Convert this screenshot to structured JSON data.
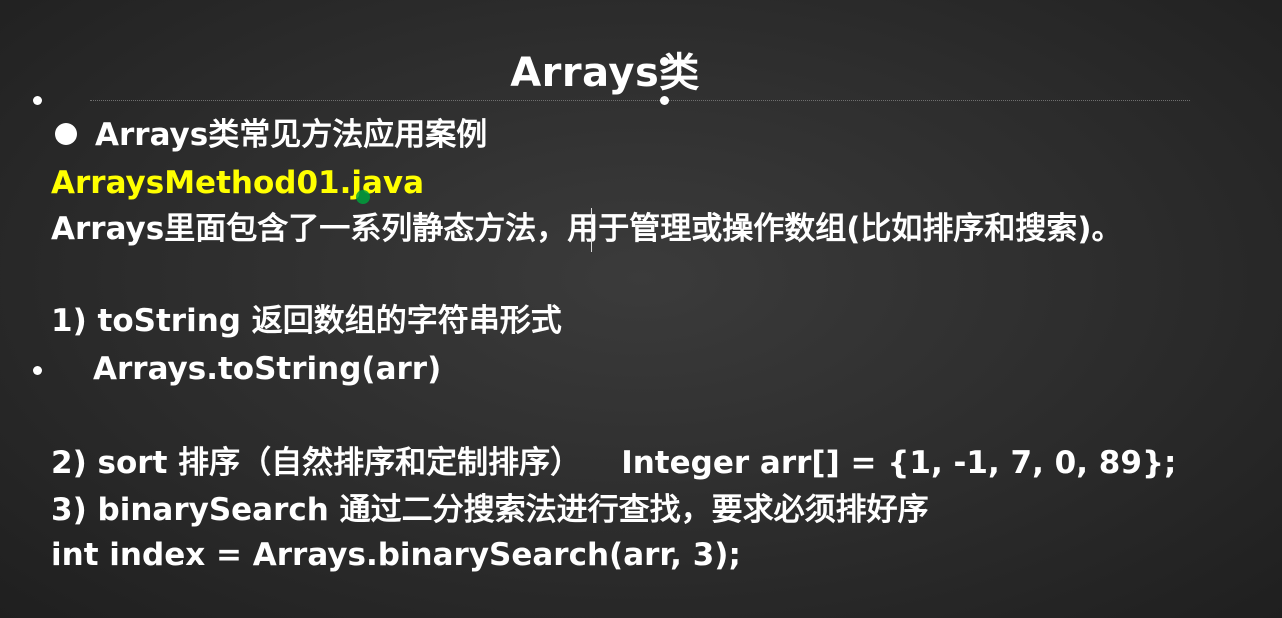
{
  "slide": {
    "title": "Arrays类",
    "bullet_heading": "Arrays类常见方法应用案例",
    "file_name": "ArraysMethod01.java",
    "description": "Arrays里面包含了一系列静态方法，用于管理或操作数组(比如排序和搜索)。",
    "item1_title": "1) toString 返回数组的字符串形式",
    "item1_code": "Arrays.toString(arr)",
    "item2_title": "2) sort 排序（自然排序和定制排序）",
    "item2_code": "Integer arr[] = {1, -1, 7, 0, 89};",
    "item3_title": "3) binarySearch 通过二分搜索法进行查找，要求必须排好序",
    "item3_code": "int index = Arrays.binarySearch(arr, 3);"
  },
  "colors": {
    "background": "#2c2c2c",
    "text": "#ffffff",
    "highlight": "#ffff00"
  }
}
